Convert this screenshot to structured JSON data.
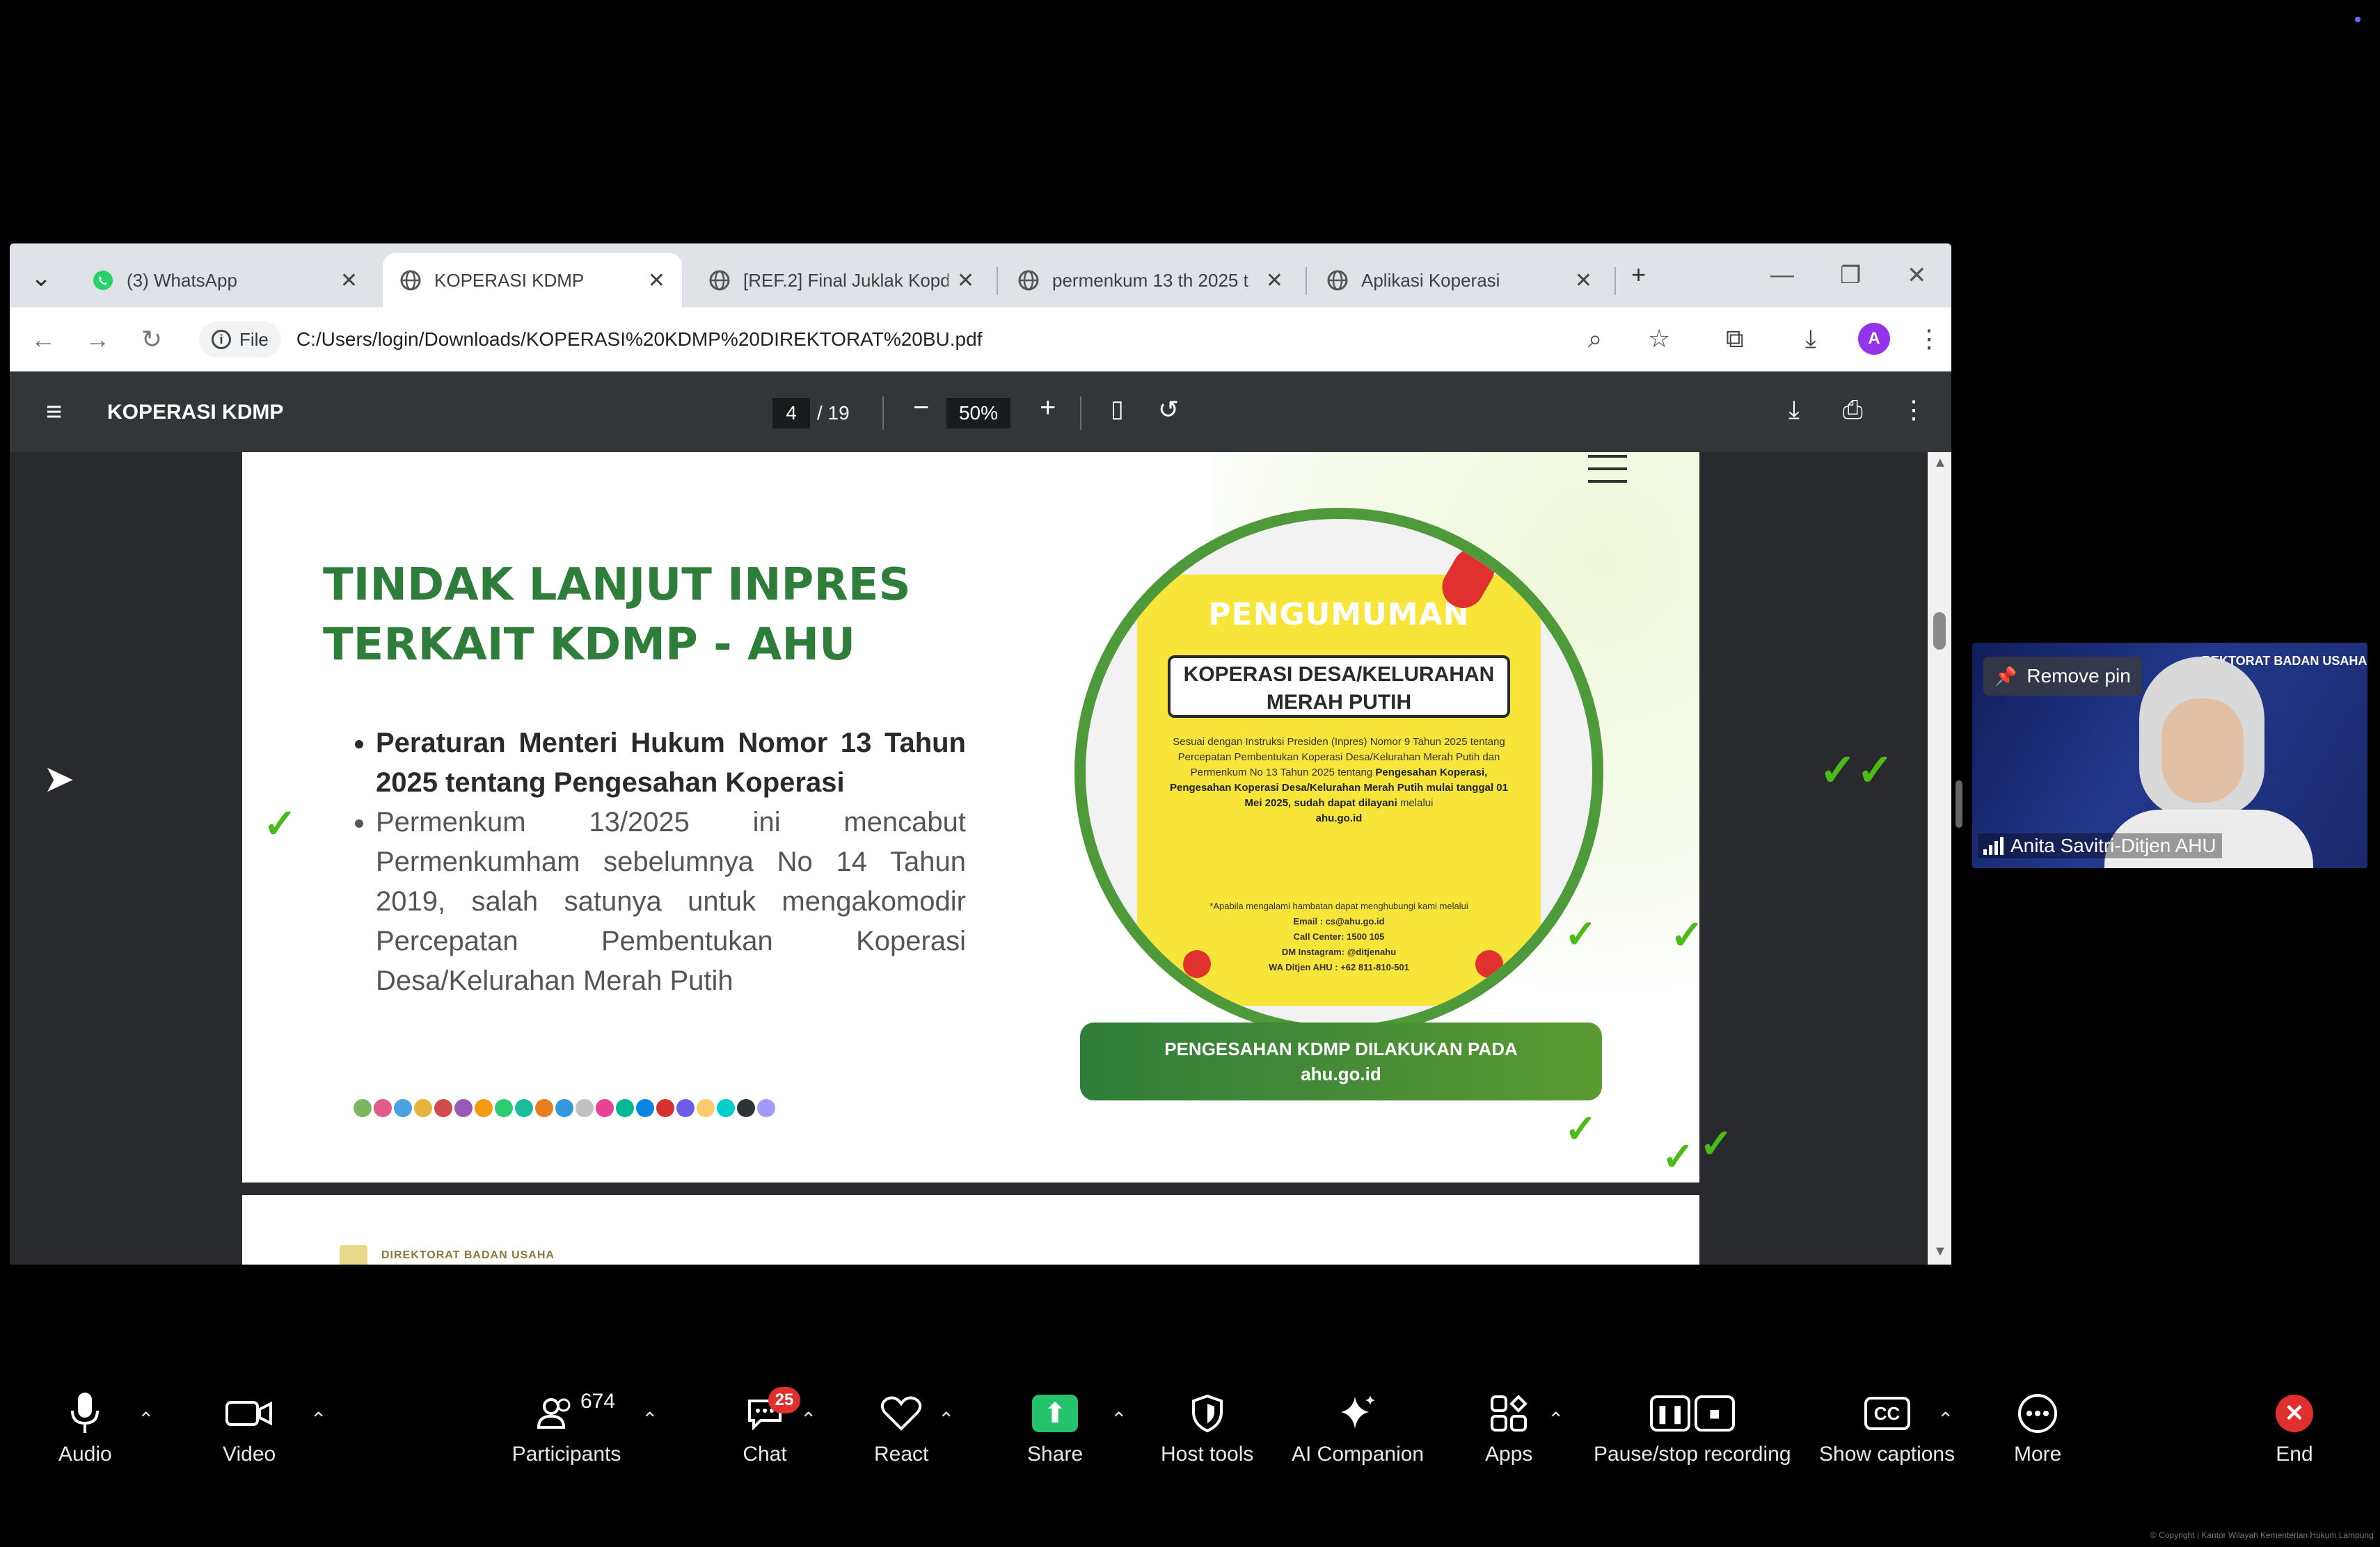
{
  "browser": {
    "tabs": [
      {
        "title": "(3) WhatsApp",
        "active": false,
        "icon": "whatsapp-icon"
      },
      {
        "title": "KOPERASI KDMP",
        "active": true,
        "icon": "globe-icon"
      },
      {
        "title": "[REF.2] Final Juklak Kopd",
        "active": false,
        "icon": "globe-icon"
      },
      {
        "title": "permenkum 13 th 2025 t",
        "active": false,
        "icon": "globe-icon"
      },
      {
        "title": "Aplikasi Koperasi",
        "active": false,
        "icon": "globe-icon"
      }
    ],
    "file_chip": "File",
    "url": "C:/Users/login/Downloads/KOPERASI%20KDMP%20DIREKTORAT%20BU.pdf",
    "avatar_letter": "A"
  },
  "pdf": {
    "title": "KOPERASI KDMP",
    "page_current": "4",
    "page_total": "/ 19",
    "zoom": "50%"
  },
  "slide": {
    "title_line1": "TINDAK LANJUT INPRES",
    "title_line2": "TERKAIT KDMP - AHU",
    "bullet1": "Peraturan Menteri Hukum Nomor 13 Tahun 2025 tentang Pengesahan Koperasi",
    "bullet2": "Permenkum 13/2025 ini mencabut Permenkumham sebelumnya No 14 Tahun 2019, salah satunya untuk mengakomodir Percepatan Pembentukan Koperasi Desa/Kelurahan Merah Putih",
    "poster": {
      "heading": "PENGUMUMAN",
      "sub_line1": "KOPERASI DESA/KELURAHAN",
      "sub_line2": "MERAH PUTIH",
      "body_intro": "Sesuai dengan Instruksi Presiden (Inpres) Nomor 9 Tahun 2025 tentang Percepatan Pembentukan Koperasi Desa/Kelurahan Merah Putih dan Permenkum No 13 Tahun 2025 tentang",
      "body_bold": "Pengesahan Koperasi, Pengesahan Koperasi Desa/Kelurahan Merah Putih mulai tanggal 01 Mei 2025, sudah dapat dilayani",
      "body_via": "melalui",
      "body_site": "ahu.go.id",
      "note": "*Apabila mengalami hambatan dapat menghubungi kami melalui",
      "email": "Email : cs@ahu.go.id",
      "callcenter": "Call Center: 1500 105",
      "instagram": "DM Instagram: @ditjenahu",
      "wa": "WA Ditjen AHU : +62 811-810-501"
    },
    "banner_line1": "PENGESAHAN KDMP DILAKUKAN PADA",
    "banner_line2": "ahu.go.id",
    "next_header": "DIREKTORAT BADAN USAHA"
  },
  "participant": {
    "remove_pin": "Remove pin",
    "name": "Anita Savitri-Ditjen AHU",
    "background_text": "REKTORAT BADAN USAHA"
  },
  "zoom_controls": {
    "audio": "Audio",
    "video": "Video",
    "participants": "Participants",
    "participants_count": "674",
    "chat": "Chat",
    "chat_badge": "25",
    "react": "React",
    "share": "Share",
    "host_tools": "Host tools",
    "ai_companion": "AI Companion",
    "apps": "Apps",
    "recording": "Pause/stop recording",
    "captions": "Show captions",
    "more": "More",
    "end": "End"
  },
  "copyright": "© Copyright | Kantor Wilayah Kementerian Hukum Lampung",
  "colors": {
    "slide_green": "#2f7d3a",
    "check_green": "#4cbb17",
    "poster_yellow": "#f7e53a",
    "share_green": "#23c26b",
    "end_red": "#e02f2f"
  }
}
